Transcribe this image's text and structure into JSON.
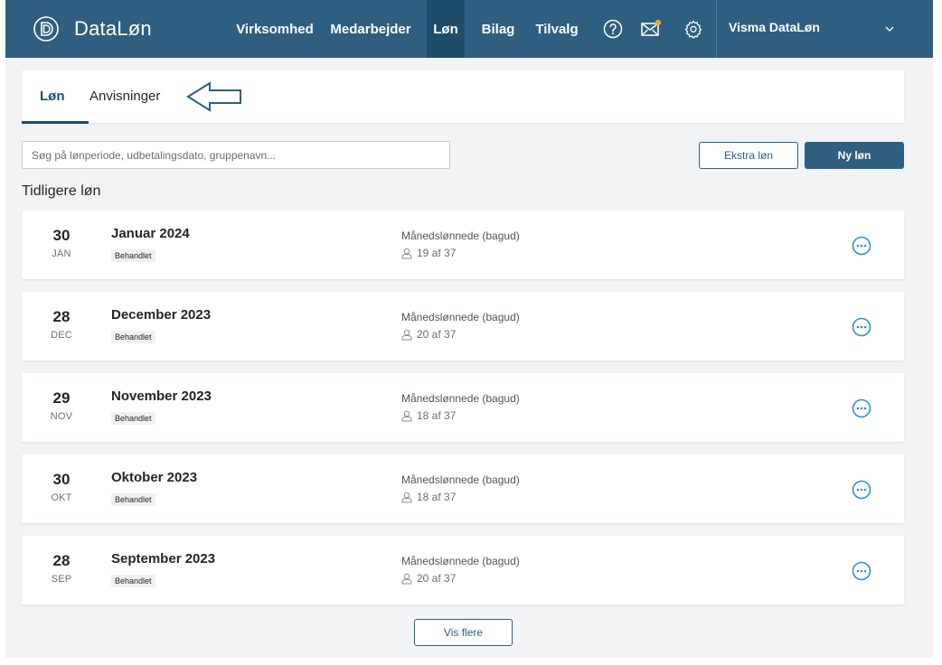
{
  "app": {
    "brand": "DataLøn"
  },
  "nav": {
    "items": [
      {
        "label": "Virksomhed",
        "active": false
      },
      {
        "label": "Medarbejder",
        "active": false
      },
      {
        "label": "Løn",
        "active": true
      },
      {
        "label": "Bilag",
        "active": false
      },
      {
        "label": "Tilvalg",
        "active": false
      }
    ],
    "icons": [
      "help-icon",
      "mail-icon",
      "settings-icon"
    ],
    "company": "Visma DataLøn"
  },
  "tabs": [
    {
      "label": "Løn",
      "active": true
    },
    {
      "label": "Anvisninger",
      "active": false
    }
  ],
  "search": {
    "placeholder": "Søg på lønperiode, udbetalingsdato, gruppenavn..."
  },
  "buttons": {
    "extra": "Ekstra løn",
    "new": "Ny løn",
    "more": "Vis flere"
  },
  "section_title": "Tidligere løn",
  "payrolls": [
    {
      "day": "30",
      "month": "JAN",
      "period": "Januar 2024",
      "status": "Behandlet",
      "group": "Månedslønnede (bagud)",
      "count": "19 af 37"
    },
    {
      "day": "28",
      "month": "DEC",
      "period": "December 2023",
      "status": "Behandlet",
      "group": "Månedslønnede (bagud)",
      "count": "20 af 37"
    },
    {
      "day": "29",
      "month": "NOV",
      "period": "November 2023",
      "status": "Behandlet",
      "group": "Månedslønnede (bagud)",
      "count": "18 af 37"
    },
    {
      "day": "30",
      "month": "OKT",
      "period": "Oktober 2023",
      "status": "Behandlet",
      "group": "Månedslønnede (bagud)",
      "count": "18 af 37"
    },
    {
      "day": "28",
      "month": "SEP",
      "period": "September 2023",
      "status": "Behandlet",
      "group": "Månedslønnede (bagud)",
      "count": "20 af 37"
    }
  ],
  "colors": {
    "header": "#2f5f80",
    "active_nav": "#1f4c6b",
    "accent": "#2f8fcf",
    "notification": "#f5a623"
  }
}
